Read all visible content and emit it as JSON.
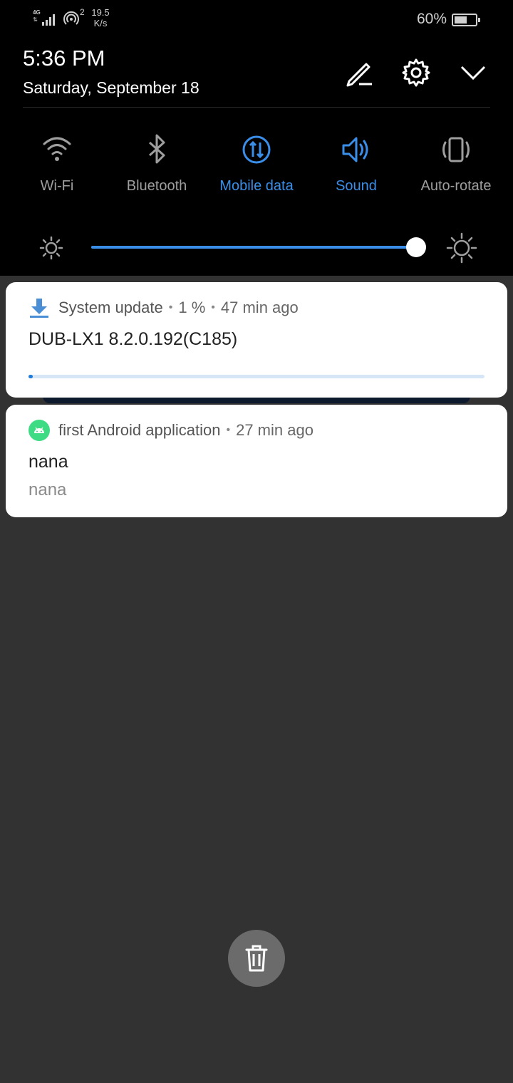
{
  "status_bar": {
    "network_type": "4G",
    "hotspot_count": "2",
    "speed_value": "19.5",
    "speed_unit": "K/s",
    "battery_percent": "60%",
    "battery_level": 0.6
  },
  "header": {
    "time": "5:36 PM",
    "date": "Saturday, September 18",
    "buttons": [
      "edit-icon",
      "settings-icon",
      "collapse-icon"
    ]
  },
  "quick_tiles": [
    {
      "label": "Wi-Fi",
      "icon": "wifi-icon",
      "active": false
    },
    {
      "label": "Bluetooth",
      "icon": "bluetooth-icon",
      "active": false
    },
    {
      "label": "Mobile data",
      "icon": "mobile-data-icon",
      "active": true
    },
    {
      "label": "Sound",
      "icon": "sound-icon",
      "active": true
    },
    {
      "label": "Auto-rotate",
      "icon": "auto-rotate-icon",
      "active": false
    }
  ],
  "brightness": {
    "level": 1.0
  },
  "notifications": [
    {
      "app": "System update",
      "progress_text": "1 %",
      "time": "47 min ago",
      "title": "DUB-LX1 8.2.0.192(C185)",
      "progress": 0.01,
      "icon": "download-icon"
    },
    {
      "app": "first Android application",
      "time": "27 min ago",
      "title": "nana",
      "text": "nana",
      "icon": "android-icon"
    }
  ],
  "clear_all_icon": "trash-icon",
  "colors": {
    "accent": "#3a8ee8",
    "shade_bg": "#000000",
    "page_bg": "#323232"
  }
}
